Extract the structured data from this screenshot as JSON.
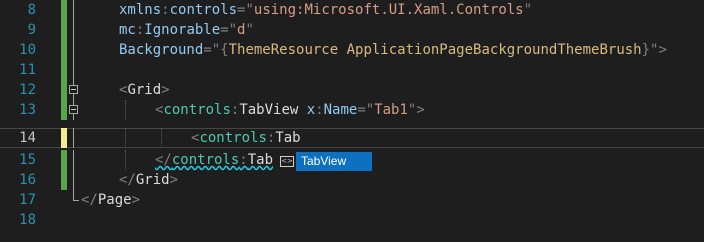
{
  "editor": {
    "lines": [
      {
        "number": "8",
        "text": "xmlns:controls=\"using:Microsoft.UI.Xaml.Controls\""
      },
      {
        "number": "9",
        "text": "mc:Ignorable=\"d\""
      },
      {
        "number": "10",
        "text": "Background=\"{ThemeResource ApplicationPageBackgroundThemeBrush}\">"
      },
      {
        "number": "11",
        "text": ""
      },
      {
        "number": "12",
        "text": "<Grid>"
      },
      {
        "number": "13",
        "text": "<controls:TabView x:Name=\"Tab1\">"
      },
      {
        "number": "14",
        "text": "<controls:Tab"
      },
      {
        "number": "15",
        "text": "</controls:Tab"
      },
      {
        "number": "16",
        "text": "</Grid>"
      },
      {
        "number": "17",
        "text": "</Page>"
      },
      {
        "number": "18",
        "text": ""
      }
    ],
    "tokens": {
      "l8": [
        "xmlns",
        ":",
        "controls",
        "=\"",
        "using:Microsoft.UI.Xaml.Controls",
        "\""
      ],
      "l9": [
        "mc",
        ":",
        "Ignorable",
        "=\"",
        "d",
        "\""
      ],
      "l10": [
        "Background",
        "=\"",
        "{",
        "ThemeResource ApplicationPageBackgroundThemeBrush",
        "}",
        "\">"
      ],
      "l12": [
        "<",
        "Grid",
        ">"
      ],
      "l13": [
        "<",
        "controls",
        ":",
        "TabView",
        " x",
        ":",
        "Name",
        "=\"",
        "Tab1",
        "\">"
      ],
      "l14": [
        "<",
        "controls",
        ":",
        "Tab"
      ],
      "l15": [
        "</",
        "controls",
        ":",
        "Tab"
      ],
      "l16": [
        "</",
        "Grid",
        ">"
      ],
      "l17": [
        "</",
        "Page",
        ">"
      ]
    }
  },
  "completion": {
    "icon": "xaml-element-icon",
    "items": [
      "TabView"
    ]
  },
  "colors": {
    "background": "#1e1e1e",
    "line_number": "#2b91af",
    "attribute": "#92caf4",
    "namespace": "#4ec9b0",
    "punctuation": "#808080",
    "string": "#d69d85",
    "markup_extension": "#d7ba7d",
    "selection": "#0e70c0",
    "saved_change": "#57a64a",
    "unsaved_change": "#efef91"
  }
}
